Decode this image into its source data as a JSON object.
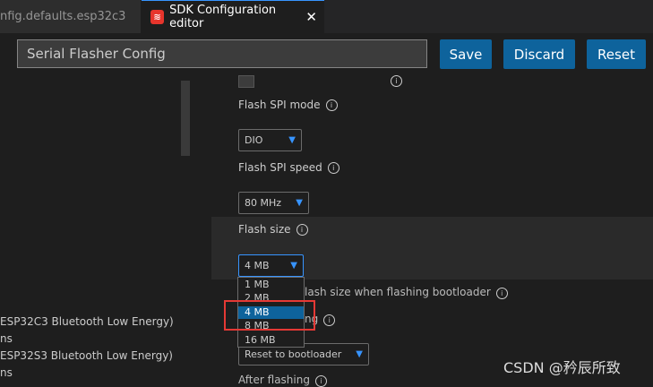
{
  "tabs": [
    {
      "label": "nfig.defaults.esp32c3"
    },
    {
      "label": "SDK Configuration editor",
      "icon": "esp-icon",
      "close": "✕"
    }
  ],
  "search": {
    "value": "Serial Flasher Config"
  },
  "buttons": {
    "save": "Save",
    "discard": "Discard",
    "reset": "Reset"
  },
  "settings": {
    "spi_mode": {
      "label": "Flash SPI mode",
      "value": "DIO"
    },
    "spi_speed": {
      "label": "Flash SPI speed",
      "value": "80 MHz"
    },
    "flash_size": {
      "label": "Flash size",
      "value": "4 MB",
      "options": [
        "1 MB",
        "2 MB",
        "4 MB",
        "8 MB",
        "16 MB"
      ],
      "selected": "4 MB"
    },
    "detect_label_partial": "lash size when flashing bootloader",
    "partial_ng": "ng",
    "before_flashing_value": "Reset to bootloader",
    "after_flashing_partial": "After flashing"
  },
  "left_panel": {
    "line1": "ESP32C3 Bluetooth Low Energy)",
    "line2": "ns",
    "line3": "ESP32S3 Bluetooth Low Energy)",
    "line4": "ns"
  },
  "watermark": "CSDN @矜辰所致",
  "colors": {
    "accent": "#0e639c",
    "highlight_border": "#e53935"
  }
}
